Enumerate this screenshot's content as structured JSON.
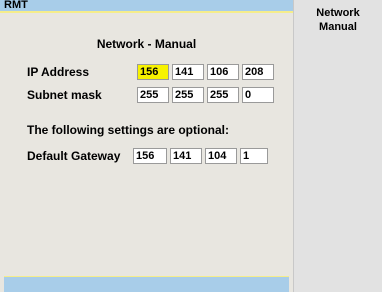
{
  "title_bar": {
    "label": "RMT"
  },
  "page": {
    "title": "Network - Manual"
  },
  "ip_address": {
    "label": "IP Address",
    "octets": [
      "156",
      "141",
      "106",
      "208"
    ]
  },
  "subnet_mask": {
    "label": "Subnet mask",
    "octets": [
      "255",
      "255",
      "255",
      "0"
    ]
  },
  "optional_note": "The following settings are optional:",
  "default_gateway": {
    "label": "Default Gateway",
    "octets": [
      "156",
      "141",
      "104",
      "1"
    ]
  },
  "softkeys": [
    {
      "line1": "Network",
      "line2": "Manual"
    }
  ],
  "colors": {
    "title_bar": "#a8cde9",
    "accent_line": "#f5ed8a",
    "panel_bg": "#e8e6e0",
    "active_field": "#f7f200",
    "softkey_bg": "#e2e2e2"
  }
}
